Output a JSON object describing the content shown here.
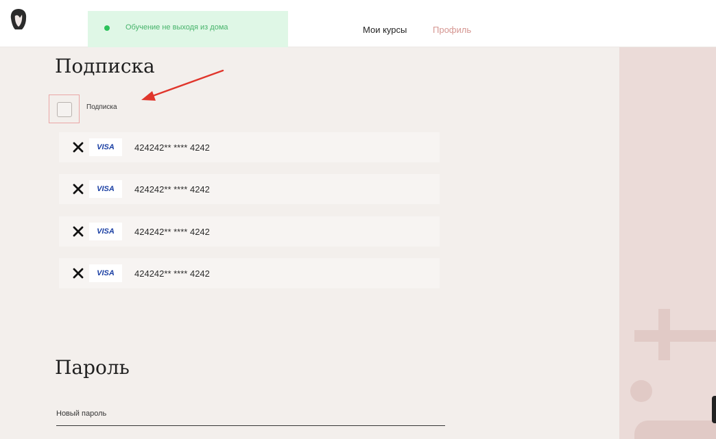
{
  "header": {
    "banner_text": "Обучение не выходя из дома",
    "nav": {
      "courses": "Мои курсы",
      "profile": "Профиль"
    },
    "colors": {
      "banner_bg": "#dff7e6",
      "banner_dot": "#2cc25b",
      "profile_link": "#d59590"
    }
  },
  "subscription": {
    "title": "Подписка",
    "checkbox_label": "Подписка",
    "checked": false
  },
  "cards": [
    {
      "brand": "VISA",
      "number": "424242** **** 4242"
    },
    {
      "brand": "VISA",
      "number": "424242** **** 4242"
    },
    {
      "brand": "VISA",
      "number": "424242** **** 4242"
    },
    {
      "brand": "VISA",
      "number": "424242** **** 4242"
    }
  ],
  "password": {
    "title": "Пароль",
    "new_password_label": "Новый пароль",
    "new_password_value": ""
  },
  "icons": {
    "logo": "woman-face-logo-icon",
    "remove": "close-x-icon",
    "annotation": "red-arrow-icon"
  }
}
